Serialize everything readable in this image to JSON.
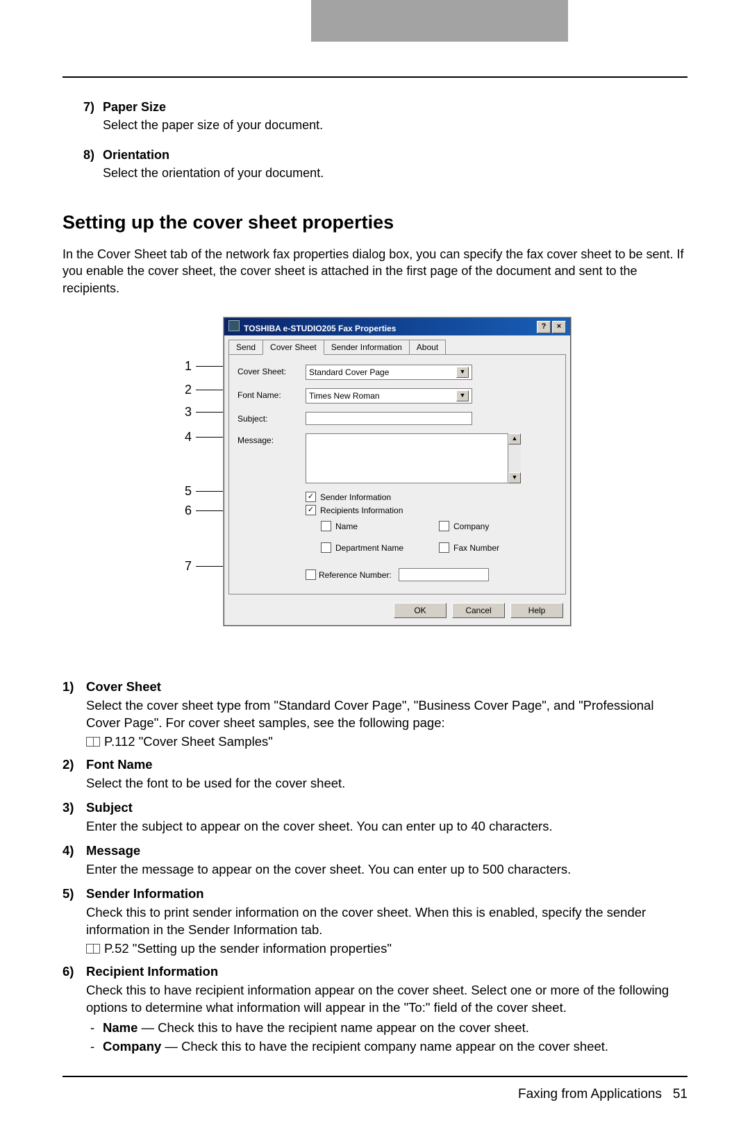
{
  "top_defs": [
    {
      "num": "7)",
      "title": "Paper Size",
      "text": "Select the paper size of your document."
    },
    {
      "num": "8)",
      "title": "Orientation",
      "text": "Select the orientation of your document."
    }
  ],
  "section_heading": "Setting up the cover sheet properties",
  "section_intro": "In the Cover Sheet tab of the network fax properties dialog box, you can specify the fax cover sheet to be sent. If you enable the cover sheet, the cover sheet is attached in the first page of the document and sent to the recipients.",
  "dialog": {
    "title": "TOSHIBA e-STUDIO205 Fax Properties",
    "help_btn": "?",
    "close_btn": "×",
    "tabs": [
      "Send",
      "Cover Sheet",
      "Sender Information",
      "About"
    ],
    "active_tab": 1,
    "fields": {
      "cover_sheet_label": "Cover Sheet:",
      "cover_sheet_value": "Standard Cover Page",
      "font_name_label": "Font Name:",
      "font_name_value": "Times New Roman",
      "subject_label": "Subject:",
      "message_label": "Message:",
      "sender_info": "Sender Information",
      "recipients_info": "Recipients Information",
      "opt_name": "Name",
      "opt_company": "Company",
      "opt_dept": "Department Name",
      "opt_fax": "Fax Number",
      "ref_num_label": "Reference Number:"
    },
    "buttons": {
      "ok": "OK",
      "cancel": "Cancel",
      "help": "Help"
    }
  },
  "callout_numbers": [
    "1",
    "2",
    "3",
    "4",
    "5",
    "6",
    "7"
  ],
  "items": [
    {
      "num": "1)",
      "title": "Cover Sheet",
      "paras": [
        "Select the cover sheet type from \"Standard Cover Page\", \"Business Cover Page\", and \"Professional Cover Page\". For cover sheet samples, see the following page:"
      ],
      "ref": "P.112 \"Cover Sheet Samples\""
    },
    {
      "num": "2)",
      "title": "Font Name",
      "paras": [
        "Select the font to be used for the cover sheet."
      ]
    },
    {
      "num": "3)",
      "title": "Subject",
      "paras": [
        "Enter the subject to appear on the cover sheet. You can enter up to 40 characters."
      ]
    },
    {
      "num": "4)",
      "title": "Message",
      "paras": [
        "Enter the message to appear on the cover sheet. You can enter up to 500 characters."
      ]
    },
    {
      "num": "5)",
      "title": "Sender Information",
      "paras": [
        "Check this to print sender information on the cover sheet. When this is enabled, specify the sender information in the Sender Information tab."
      ],
      "ref": "P.52 \"Setting up the sender information properties\""
    },
    {
      "num": "6)",
      "title": "Recipient Information",
      "paras": [
        "Check this to have recipient information appear on the cover sheet. Select one or more of the following options to determine what information will appear in the \"To:\" field of the cover sheet."
      ],
      "subs": [
        {
          "label": "Name",
          "text": " — Check this to have the recipient name appear on the cover sheet."
        },
        {
          "label": "Company",
          "text": " — Check this to have the recipient company name appear on the cover sheet."
        }
      ]
    }
  ],
  "footer": {
    "text": "Faxing from Applications",
    "page": "51"
  }
}
